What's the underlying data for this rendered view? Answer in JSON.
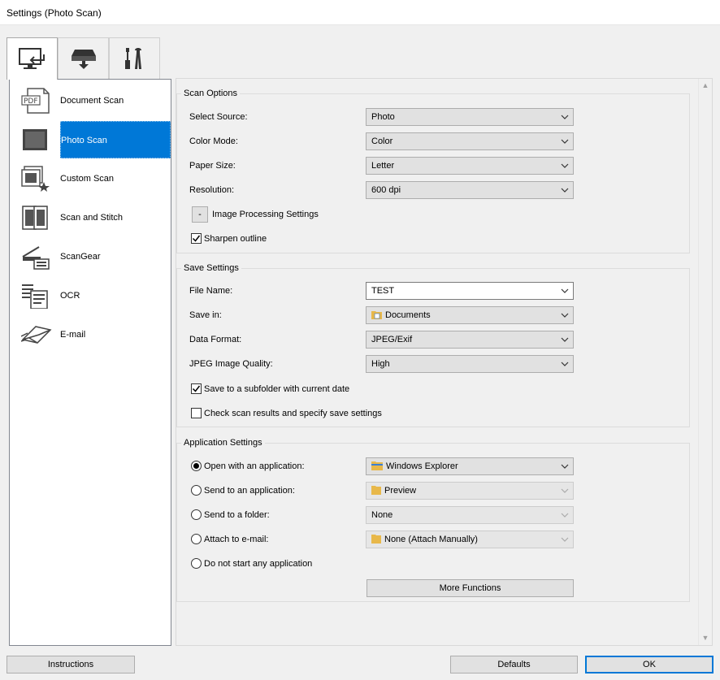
{
  "window": {
    "title": "Settings (Photo Scan)"
  },
  "tabs": [
    {
      "name": "scan-from-computer",
      "icon": "monitor-scan-icon",
      "active": true
    },
    {
      "name": "scan-from-operation-panel",
      "icon": "scanner-download-icon",
      "active": false
    },
    {
      "name": "general-settings",
      "icon": "tools-icon",
      "active": false
    }
  ],
  "nav": {
    "items": [
      {
        "label": "Document Scan",
        "icon": "pdf-document-icon"
      },
      {
        "label": "Photo Scan",
        "icon": "photo-icon",
        "selected": true
      },
      {
        "label": "Custom Scan",
        "icon": "custom-scan-star-icon"
      },
      {
        "label": "Scan and Stitch",
        "icon": "stitch-icon"
      },
      {
        "label": "ScanGear",
        "icon": "scanner-icon"
      },
      {
        "label": "OCR",
        "icon": "ocr-text-icon"
      },
      {
        "label": "E-mail",
        "icon": "email-envelope-icon"
      }
    ]
  },
  "scan_options": {
    "legend": "Scan Options",
    "source_label": "Select Source:",
    "source_value": "Photo",
    "color_label": "Color Mode:",
    "color_value": "Color",
    "paper_label": "Paper Size:",
    "paper_value": "Letter",
    "resolution_label": "Resolution:",
    "resolution_value": "600 dpi",
    "image_processing_toggle": "-",
    "image_processing_label": "Image Processing Settings",
    "sharpen_label": "Sharpen outline",
    "sharpen_checked": true
  },
  "save_settings": {
    "legend": "Save Settings",
    "file_name_label": "File Name:",
    "file_name_value": "TEST",
    "save_in_label": "Save in:",
    "save_in_value": "Documents",
    "data_format_label": "Data Format:",
    "data_format_value": "JPEG/Exif",
    "jpeg_quality_label": "JPEG Image Quality:",
    "jpeg_quality_value": "High",
    "subfolder_label": "Save to a subfolder with current date",
    "subfolder_checked": true,
    "check_results_label": "Check scan results and specify save settings",
    "check_results_checked": false
  },
  "app_settings": {
    "legend": "Application Settings",
    "open_app_label": "Open with an application:",
    "open_app_value": "Windows Explorer",
    "send_app_label": "Send to an application:",
    "send_app_value": "Preview",
    "send_folder_label": "Send to a folder:",
    "send_folder_value": "None",
    "attach_email_label": "Attach to e-mail:",
    "attach_email_value": "None (Attach Manually)",
    "no_app_label": "Do not start any application",
    "more_functions_label": "More Functions"
  },
  "footer": {
    "instructions_label": "Instructions",
    "defaults_label": "Defaults",
    "ok_label": "OK"
  },
  "colors": {
    "selection": "#0078d7",
    "window_bg": "#f0f0f0",
    "button_bg": "#e1e1e1"
  }
}
